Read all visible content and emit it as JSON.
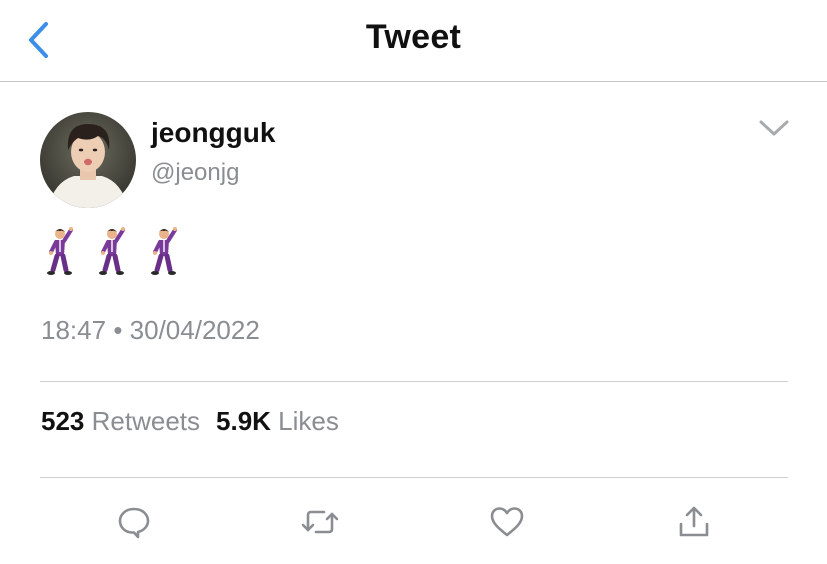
{
  "header": {
    "title": "Tweet"
  },
  "author": {
    "name": "jeongguk",
    "handle": "@jeonjg"
  },
  "tweet": {
    "content_emoji": [
      "man-dancing",
      "man-dancing",
      "man-dancing"
    ],
    "time": "18:47",
    "separator": "•",
    "date": "30/04/2022"
  },
  "stats": {
    "retweets_count": "523",
    "retweets_label": "Retweets",
    "likes_count": "5.9K",
    "likes_label": "Likes"
  },
  "actions": {
    "icons": [
      "reply-icon",
      "retweet-icon",
      "like-icon",
      "share-icon"
    ]
  },
  "colors": {
    "accent": "#3a8ee6",
    "secondary_text": "#8a8d91",
    "primary_text": "#111111",
    "divider": "#d0d0d0"
  }
}
